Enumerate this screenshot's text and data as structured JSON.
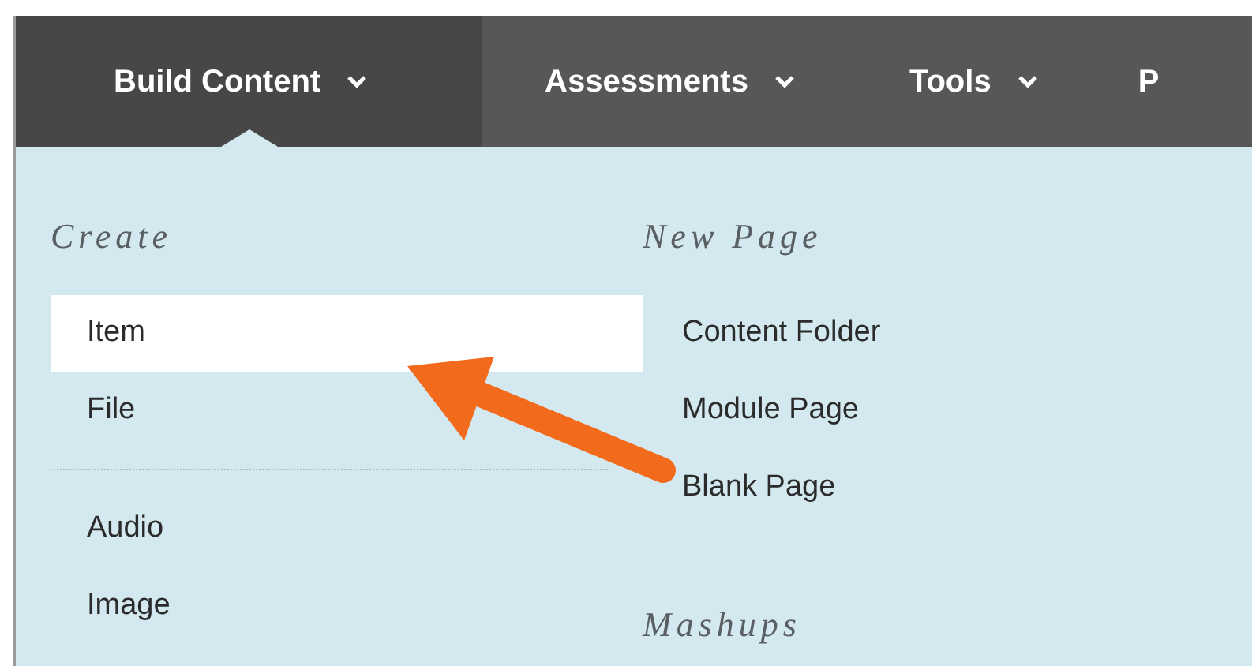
{
  "tabs": [
    {
      "label": "Build Content",
      "dropdown": true,
      "selected": true
    },
    {
      "label": "Assessments",
      "dropdown": true,
      "selected": false
    },
    {
      "label": "Tools",
      "dropdown": true,
      "selected": false
    },
    {
      "label": "P",
      "dropdown": false,
      "selected": false
    }
  ],
  "menu": {
    "columns": [
      {
        "sections": [
          {
            "heading": "Create",
            "groups": [
              [
                {
                  "label": "Item",
                  "selected": true
                },
                {
                  "label": "File",
                  "selected": false
                }
              ],
              [
                {
                  "label": "Audio",
                  "selected": false
                },
                {
                  "label": "Image",
                  "selected": false
                }
              ]
            ]
          }
        ]
      },
      {
        "sections": [
          {
            "heading": "New Page",
            "groups": [
              [
                {
                  "label": "Content Folder",
                  "selected": false
                },
                {
                  "label": "Module Page",
                  "selected": false
                },
                {
                  "label": "Blank Page",
                  "selected": false
                }
              ]
            ]
          },
          {
            "heading": "Mashups"
          }
        ]
      }
    ]
  },
  "annotation": {
    "kind": "arrow"
  }
}
